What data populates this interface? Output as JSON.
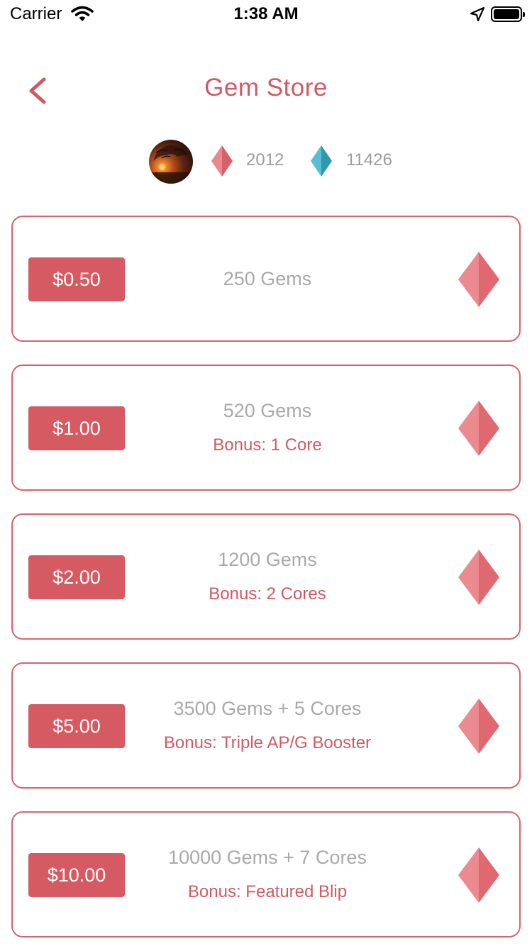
{
  "status_bar": {
    "carrier": "Carrier",
    "time": "1:38 AM"
  },
  "header": {
    "title": "Gem Store",
    "back_icon": "chevron-left-icon"
  },
  "balances": {
    "avatar": "user-avatar",
    "red_gems": "2012",
    "blue_gems": "11426"
  },
  "colors": {
    "accent": "#d65a62",
    "border": "#d8636b",
    "muted_text": "#a9a9a9",
    "red_gem": "#e88288",
    "blue_gem": "#4ab4c8"
  },
  "packages": [
    {
      "price": "$0.50",
      "gems": "250 Gems",
      "bonus": ""
    },
    {
      "price": "$1.00",
      "gems": "520 Gems",
      "bonus": "Bonus: 1 Core"
    },
    {
      "price": "$2.00",
      "gems": "1200 Gems",
      "bonus": "Bonus: 2 Cores"
    },
    {
      "price": "$5.00",
      "gems": "3500 Gems + 5 Cores",
      "bonus": "Bonus: Triple AP/G Booster"
    },
    {
      "price": "$10.00",
      "gems": "10000 Gems + 7 Cores",
      "bonus": "Bonus: Featured Blip"
    }
  ]
}
